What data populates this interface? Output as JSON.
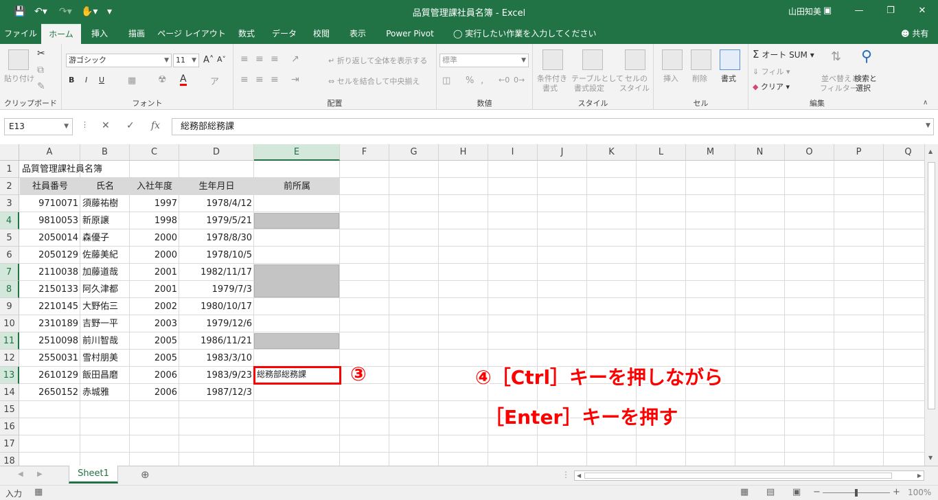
{
  "app": {
    "window_title": "品質管理課社員名簿 - Excel",
    "user": "山田知美"
  },
  "quick_access": {
    "save_icon": "save-icon",
    "undo_icon": "undo-icon",
    "redo_icon": "redo-icon",
    "touch_icon": "touch-mode-icon"
  },
  "tabs": [
    {
      "label": "ファイル"
    },
    {
      "label": "ホーム",
      "active": true
    },
    {
      "label": "挿入"
    },
    {
      "label": "描画"
    },
    {
      "label": "ページ レイアウト"
    },
    {
      "label": "数式"
    },
    {
      "label": "データ"
    },
    {
      "label": "校閲"
    },
    {
      "label": "表示"
    },
    {
      "label": "Power Pivot"
    }
  ],
  "tell_me": "実行したい作業を入力してください",
  "share": "共有",
  "ribbon": {
    "clipboard": {
      "paste": "貼り付け",
      "group": "クリップボード"
    },
    "font": {
      "name": "游ゴシック",
      "size": "11",
      "bold": "B",
      "italic": "I",
      "underline": "U",
      "group": "フォント",
      "font_color": "#ff0000"
    },
    "alignment": {
      "wrap": "折り返して全体を表示する",
      "merge": "セルを結合して中央揃え",
      "group": "配置"
    },
    "number": {
      "format": "標準",
      "percent": "%",
      "group": "数値"
    },
    "styles": {
      "conditional": "条件付き",
      "conditional2": "書式",
      "table": "テーブルとして",
      "table2": "書式設定",
      "cell": "セルの",
      "cell2": "スタイル",
      "group": "スタイル"
    },
    "cells": {
      "insert": "挿入",
      "delete": "削除",
      "format": "書式",
      "group": "セル"
    },
    "editing": {
      "autosum": "オート SUM",
      "fill": "フィル",
      "clear": "クリア",
      "sort": "並べ替えと",
      "sort2": "フィルター",
      "find": "検索と",
      "find2": "選択",
      "group": "編集"
    }
  },
  "formula_bar": {
    "name_box": "E13",
    "value": "総務部総務課"
  },
  "columns": [
    "A",
    "B",
    "C",
    "D",
    "E",
    "F",
    "G",
    "H",
    "I",
    "J",
    "K",
    "L",
    "M",
    "N",
    "O",
    "P",
    "Q"
  ],
  "rows": [
    "1",
    "2",
    "3",
    "4",
    "5",
    "6",
    "7",
    "8",
    "9",
    "10",
    "11",
    "12",
    "13",
    "14",
    "15",
    "16",
    "17",
    "18"
  ],
  "sheet": {
    "title": "品質管理課社員名簿",
    "headers": [
      "社員番号",
      "氏名",
      "入社年度",
      "生年月日",
      "前所属"
    ],
    "data": [
      [
        "9710071",
        "須藤祐樹",
        "1997",
        "1978/4/12"
      ],
      [
        "9810053",
        "新原譲",
        "1998",
        "1979/5/21"
      ],
      [
        "2050014",
        "森優子",
        "2000",
        "1978/8/30"
      ],
      [
        "2050129",
        "佐藤美紀",
        "2000",
        "1978/10/5"
      ],
      [
        "2110038",
        "加藤道哉",
        "2001",
        "1982/11/17"
      ],
      [
        "2150133",
        "阿久津都",
        "2001",
        "1979/7/3"
      ],
      [
        "2210145",
        "大野佑三",
        "2002",
        "1980/10/17"
      ],
      [
        "2310189",
        "吉野一平",
        "2003",
        "1979/12/6"
      ],
      [
        "2510098",
        "前川智哉",
        "2005",
        "1986/11/21"
      ],
      [
        "2550031",
        "雪村朋美",
        "2005",
        "1983/3/10"
      ],
      [
        "2610129",
        "飯田昌磨",
        "2006",
        "1983/9/23"
      ],
      [
        "2650152",
        "赤城雅",
        "2006",
        "1987/12/3"
      ]
    ],
    "active_cell_value": "総務部総務課"
  },
  "annotations": {
    "step3": "③",
    "step4_line1": "④［Ctrl］キーを押しながら",
    "step4_line2": "［Enter］キーを押す"
  },
  "sheet_tabs": [
    {
      "label": "Sheet1"
    }
  ],
  "status": {
    "mode": "入力",
    "zoom": "100%"
  },
  "colors": {
    "accent": "#217346",
    "annotation": "#ff0000",
    "selection": "#c4c4c4"
  }
}
